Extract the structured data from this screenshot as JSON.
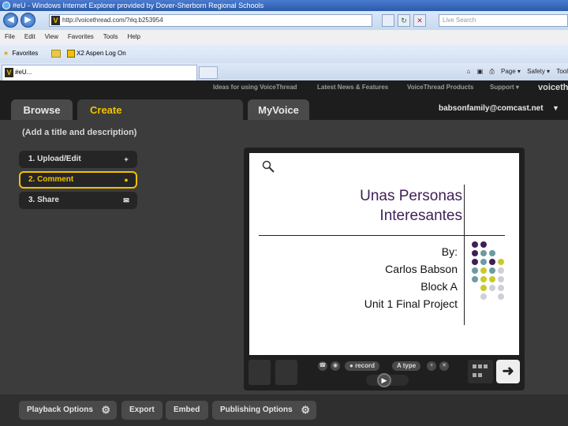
{
  "browser": {
    "title": "#eU - Windows Internet Explorer provided by Dover-Sherborn Regional Schools",
    "back_glyph": "◀",
    "forward_glyph": "▶",
    "address": "http://voicethread.com/?#q.b253954",
    "refresh_glyph": "↻",
    "stop_glyph": "✕",
    "search_placeholder": "Live Search",
    "menu": [
      "File",
      "Edit",
      "View",
      "Favorites",
      "Tools",
      "Help"
    ],
    "favorites": {
      "label": "Favorites",
      "link": "X2 Aspen Log On"
    },
    "tab_title": "#eU...",
    "tools": [
      "Page ▾",
      "Safety ▾",
      "Tool"
    ]
  },
  "vt": {
    "top_links": [
      "Ideas for using VoiceThread",
      "Latest News & Features",
      "VoiceThread Products",
      "Support ▾"
    ],
    "brand": "voicethr",
    "tabs": {
      "browse": "Browse",
      "create": "Create",
      "myvoice": "MyVoice"
    },
    "account": "babsonfamily@comcast.net",
    "account_arrow": "▼",
    "title": "(Add a title and description)",
    "steps": [
      {
        "label": "1. Upload/Edit",
        "icon": "+"
      },
      {
        "label": "2. Comment",
        "icon": "●"
      },
      {
        "label": "3. Share",
        "icon": "✉"
      }
    ]
  },
  "slide": {
    "title_line1": "Unas Personas",
    "title_line2": "Interesantes",
    "lines": [
      "By:",
      "Carlos Babson",
      "Block A",
      "Unit 1 Final Project"
    ],
    "colors": {
      "purple": "#3e1f56",
      "teal": "#6d9ba1",
      "lime": "#c9c92a",
      "gray": "#cfcfd8"
    },
    "dot_grid": [
      [
        "purple",
        "purple",
        "",
        ""
      ],
      [
        "purple",
        "teal",
        "teal",
        ""
      ],
      [
        "purple",
        "teal",
        "purple",
        "lime"
      ],
      [
        "teal",
        "lime",
        "teal",
        "gray"
      ],
      [
        "teal",
        "lime",
        "lime",
        "gray"
      ],
      [
        "",
        "lime",
        "gray",
        "gray"
      ],
      [
        "",
        "gray",
        "",
        "gray"
      ]
    ]
  },
  "controls": {
    "record": "record",
    "type": "type",
    "next_glyph": "➜",
    "play_glyph": "▶"
  },
  "bottom": {
    "playback": "Playback Options",
    "export": "Export",
    "embed": "Embed",
    "publishing": "Publishing Options",
    "gear": "⚙"
  }
}
